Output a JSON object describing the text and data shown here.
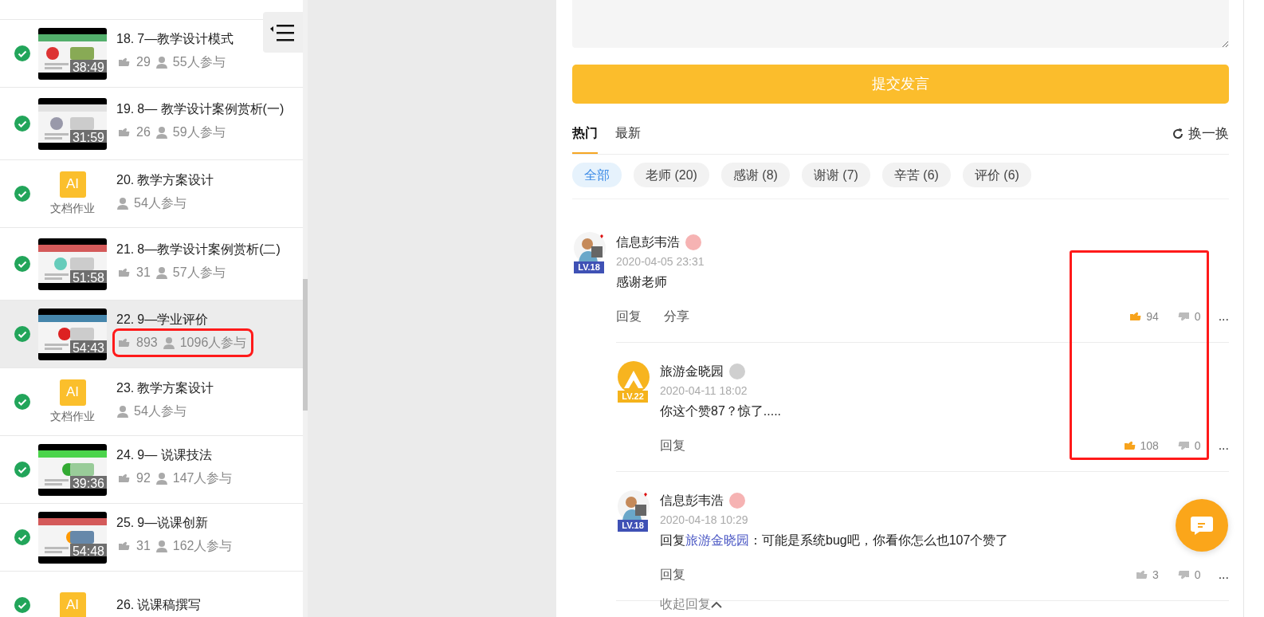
{
  "sidebar": {
    "items": [
      {
        "kind": "video",
        "done": true,
        "selected": false,
        "highlighted": false,
        "number": "18.",
        "title": "7—教学设计模式",
        "duration": "38:49",
        "likes": "29",
        "participants": "55人参与"
      },
      {
        "kind": "video",
        "done": true,
        "selected": false,
        "highlighted": false,
        "number": "19.",
        "title": "8— 教学设计案例赏析(一)",
        "duration": "31:59",
        "likes": "26",
        "participants": "59人参与"
      },
      {
        "kind": "document",
        "done": true,
        "selected": false,
        "highlighted": false,
        "number": "20.",
        "title": "教学方案设计",
        "badge": "AI",
        "badge_label": "文档作业",
        "participants": "54人参与"
      },
      {
        "kind": "video",
        "done": true,
        "selected": false,
        "highlighted": false,
        "number": "21.",
        "title": "8—教学设计案例赏析(二)",
        "duration": "51:58",
        "likes": "31",
        "participants": "57人参与"
      },
      {
        "kind": "video",
        "done": true,
        "selected": true,
        "highlighted": true,
        "number": "22.",
        "title": "9—学业评价",
        "duration": "54:43",
        "likes": "893",
        "participants": "1096人参与"
      },
      {
        "kind": "document",
        "done": true,
        "selected": false,
        "highlighted": false,
        "number": "23.",
        "title": "教学方案设计",
        "badge": "AI",
        "badge_label": "文档作业",
        "participants": "54人参与"
      },
      {
        "kind": "video",
        "done": true,
        "selected": false,
        "highlighted": false,
        "number": "24.",
        "title": "9— 说课技法",
        "duration": "39:36",
        "likes": "92",
        "participants": "147人参与"
      },
      {
        "kind": "video",
        "done": true,
        "selected": false,
        "highlighted": false,
        "number": "25.",
        "title": "9—说课创新",
        "duration": "54:48",
        "likes": "31",
        "participants": "162人参与"
      },
      {
        "kind": "document",
        "done": true,
        "selected": false,
        "number": "26.",
        "title": "说课稿撰写",
        "badge": "AI"
      }
    ]
  },
  "submit_button": "提交发言",
  "tabs": [
    {
      "label": "热门",
      "selected": true
    },
    {
      "label": "最新",
      "selected": false
    }
  ],
  "refresh": "换一换",
  "filters": [
    {
      "label": "全部",
      "selected": true
    },
    {
      "label": "老师 (20)",
      "selected": false
    },
    {
      "label": "感谢 (8)",
      "selected": false
    },
    {
      "label": "谢谢 (7)",
      "selected": false
    },
    {
      "label": "辛苦 (6)",
      "selected": false
    },
    {
      "label": "评价 (6)",
      "selected": false
    }
  ],
  "comments": {
    "votes_highlighted": true,
    "items": [
      {
        "author": "信息彭韦浩",
        "level": {
          "text": "LV.18",
          "color": "#3f51b5"
        },
        "medal": {
          "color": "#f6b3b3"
        },
        "time": "2020-04-05 23:31",
        "text": "感谢老师",
        "actions": [
          "回复",
          "分享"
        ],
        "likes": "94",
        "dislikes": "0",
        "liked": true,
        "more": "...",
        "replies": [
          {
            "author": "旅游金晓园",
            "level": {
              "text": "LV.22",
              "color": "#f5b31c"
            },
            "medal": {
              "color": "#cfcfcf"
            },
            "time": "2020-04-11 18:02",
            "text": "你这个赞87？惊了.....",
            "actions": [
              "回复"
            ],
            "likes": "108",
            "dislikes": "0",
            "liked": true,
            "more": "..."
          },
          {
            "author": "信息彭韦浩",
            "level": {
              "text": "LV.18",
              "color": "#3f51b5"
            },
            "medal": {
              "color": "#f6b3b3"
            },
            "time": "2020-04-18 10:29",
            "reply_prefix": "回复",
            "reply_to": "旅游金晓园",
            "text": "：可能是系统bug吧，你看你怎么也107个赞了",
            "actions": [
              "回复"
            ],
            "likes": "3",
            "dislikes": "0",
            "liked": false,
            "more": "..."
          }
        ],
        "collapse": "收起回复"
      }
    ]
  }
}
